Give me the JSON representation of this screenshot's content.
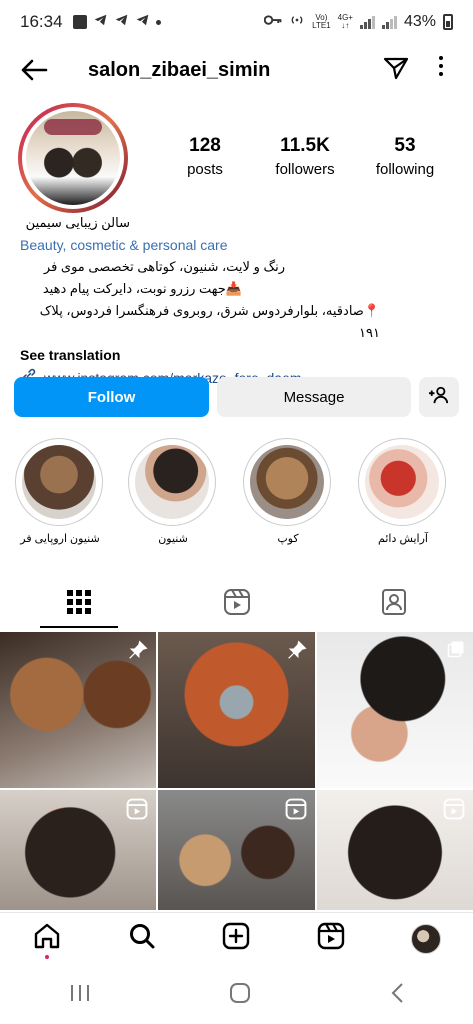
{
  "status_bar": {
    "time": "16:34",
    "network_label_top": "Vo)",
    "network_label_bottom": "LTE1",
    "network_type": "4G+",
    "battery": "43%"
  },
  "header": {
    "username": "salon_zibaei_simin",
    "icons": [
      "back-arrow-icon",
      "send-icon",
      "more-icon"
    ]
  },
  "profile": {
    "stats": [
      {
        "value": "128",
        "label": "posts"
      },
      {
        "value": "11.5K",
        "label": "followers"
      },
      {
        "value": "53",
        "label": "following"
      }
    ],
    "display_name": "سالن زیبایی سیمین",
    "category": "Beauty, cosmetic & personal care",
    "bio_lines": [
      "رنگ و لایت، شنیون، کوتاهی تخصصی موی فر",
      "📥جهت رزرو نوبت، دایرکت پیام دهید",
      "📍صادقیه، بلوارفردوس شرق، روبروی فرهنگسرا فردوس، پلاک ۱۹۱"
    ],
    "see_translation": "See translation",
    "link": "www.instagram.com/markaze_fere_daem"
  },
  "actions": {
    "follow": "Follow",
    "message": "Message"
  },
  "highlights": [
    {
      "label": "شنیون اروپایی فر",
      "color": "#8a6a4a"
    },
    {
      "label": "شنیون",
      "color": "#3d3530"
    },
    {
      "label": "کوپ",
      "color": "#a0784e"
    },
    {
      "label": "آرایش دائم",
      "color": "#c0392b"
    }
  ],
  "tabs": [
    "grid-icon",
    "reels-icon",
    "tagged-icon"
  ],
  "bottom_nav": [
    "home-icon",
    "search-icon",
    "create-icon",
    "reels-icon",
    "profile-avatar"
  ],
  "colors": {
    "accent": "#0095f6",
    "link": "#1e4c85",
    "category": "#3a6fb0"
  }
}
